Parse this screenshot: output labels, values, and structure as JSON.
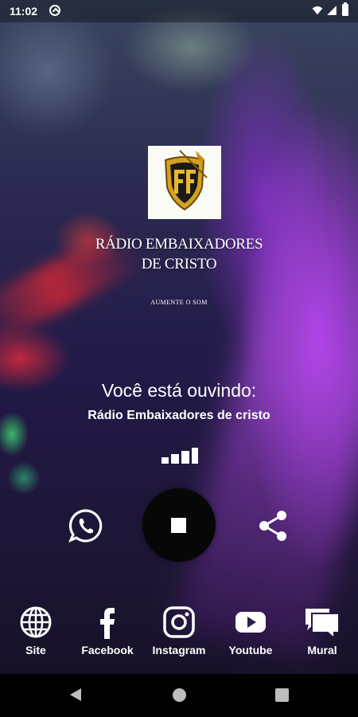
{
  "status_bar": {
    "time": "11:02",
    "icons": [
      "app-notification-icon",
      "wifi-icon",
      "signal-icon",
      "battery-icon"
    ]
  },
  "station_logo": {
    "title_line1": "RÁDIO EMBAIXADORES",
    "title_line2": "DE CRISTO",
    "tagline": "AUMENTE O SOM"
  },
  "player": {
    "listening_label": "Você está ouvindo:",
    "station_name": "Rádio Embaixadores de cristo",
    "state": "playing",
    "controls": [
      "whatsapp-icon",
      "stop-icon",
      "share-icon"
    ]
  },
  "bottom_nav": {
    "items": [
      {
        "label": "Site",
        "icon": "globe-icon"
      },
      {
        "label": "Facebook",
        "icon": "facebook-icon"
      },
      {
        "label": "Instagram",
        "icon": "instagram-icon"
      },
      {
        "label": "Youtube",
        "icon": "youtube-icon"
      },
      {
        "label": "Mural",
        "icon": "chat-icon"
      }
    ]
  },
  "system_nav": [
    "back-icon",
    "home-icon",
    "recents-icon"
  ],
  "colors": {
    "accent_purple": "#a23ce6",
    "stop_button_bg": "#070707",
    "logo_bg": "#fbfbf6",
    "logo_gold": "#d4a020"
  }
}
